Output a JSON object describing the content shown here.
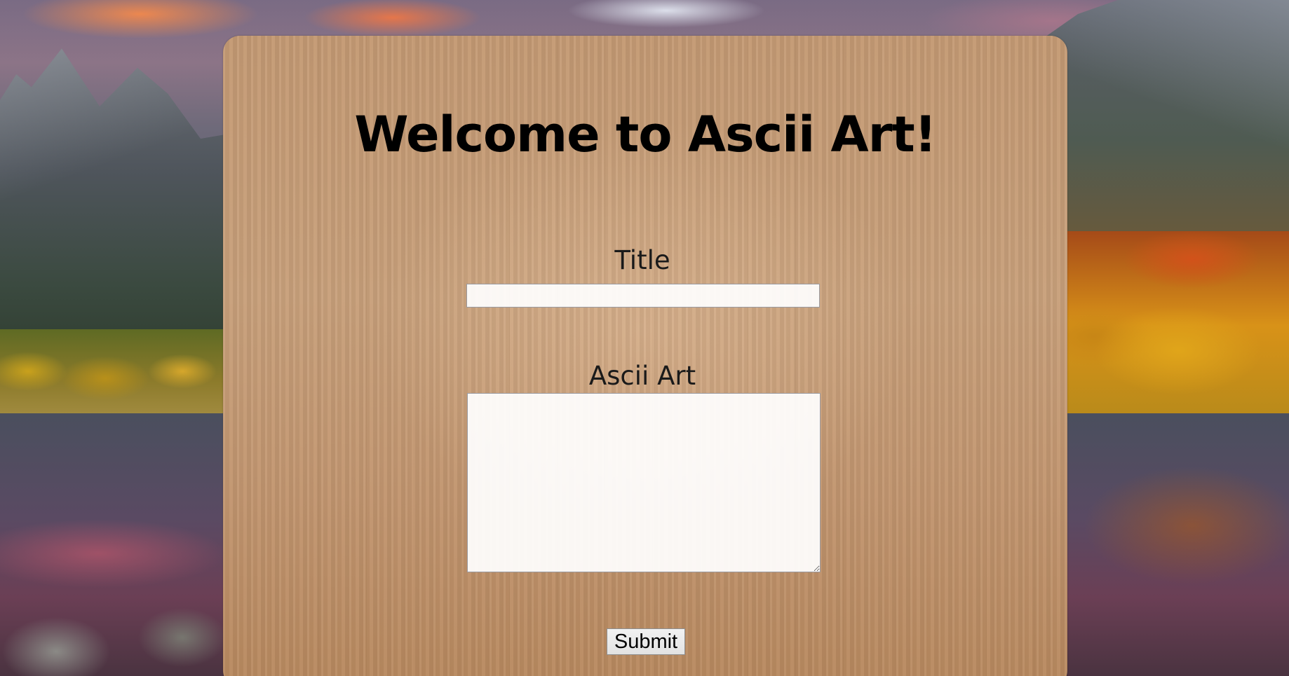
{
  "page": {
    "heading": "Welcome to Ascii Art!"
  },
  "form": {
    "title_label": "Title",
    "title_value": "",
    "ascii_label": "Ascii Art",
    "ascii_value": "",
    "submit_label": "Submit"
  },
  "colors": {
    "panel_wood": "#c49a74",
    "heading_text": "#000000",
    "field_background": "#f6f6f6"
  }
}
